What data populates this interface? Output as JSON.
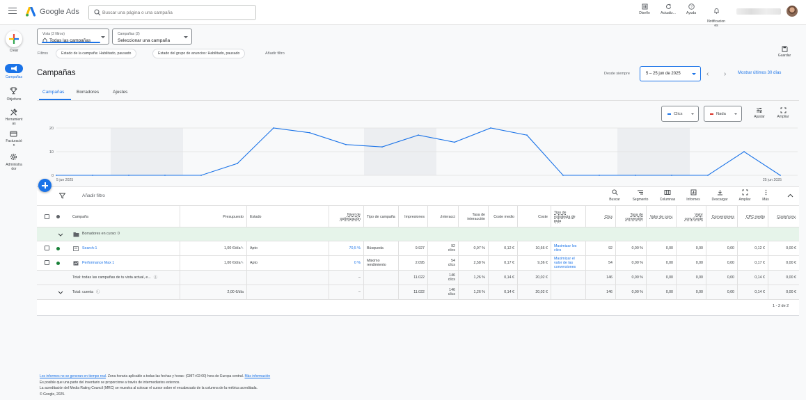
{
  "app": {
    "brand": "Google Ads"
  },
  "search": {
    "placeholder": "Buscar una página o una campaña"
  },
  "toolbar": {
    "items": [
      "Diseño",
      "Actualiz...",
      "Ayuda",
      "Notificacion\nes"
    ]
  },
  "rail": {
    "items": [
      "Crear",
      "Campañas",
      "Objetivos",
      "Herramient\nas",
      "Facturació\nn",
      "Administra\ndor"
    ]
  },
  "view_select": {
    "label": "Vista (2 filtros)",
    "value": "Todas las campañas"
  },
  "campaign_select": {
    "label": "Campañas (2)",
    "value": "Seleccionar una campaña"
  },
  "filters": {
    "label": "Filtros",
    "chips": [
      "Estado de la campaña: Habilitado, pausado",
      "Estado del grupo de anuncios: Habilitado, pausado"
    ],
    "add": "Añadir filtro",
    "save": "Guardar"
  },
  "page": {
    "title": "Campañas"
  },
  "tabs": [
    "Campañas",
    "Borradores",
    "Ajustes"
  ],
  "date": {
    "since": "Desde siempre",
    "range": "5 – 25 jun de 2025",
    "show_last": "Mostrar últimos 30 días"
  },
  "metrics": {
    "primary": "Clics",
    "primary_color": "#1a73e8",
    "secondary": "Nada",
    "secondary_color": "#d93025"
  },
  "chart_tools": [
    "Ajustar",
    "Ampliar"
  ],
  "chart_data": {
    "type": "line",
    "x": [
      "5 jun 2025",
      "6 jun",
      "7 jun",
      "8 jun",
      "9 jun",
      "10 jun",
      "11 jun",
      "12 jun",
      "13 jun",
      "14 jun",
      "15 jun",
      "16 jun",
      "17 jun",
      "18 jun",
      "19 jun",
      "20 jun",
      "21 jun",
      "22 jun",
      "23 jun",
      "24 jun",
      "25 jun 2025"
    ],
    "series": [
      {
        "values": [
          0,
          0,
          0,
          0,
          0,
          5,
          20,
          18,
          13,
          12,
          17,
          14,
          20,
          17,
          0,
          0,
          0,
          0,
          0,
          10,
          0
        ]
      }
    ],
    "ylim": [
      0,
      20
    ],
    "yticks": [
      "0",
      "10",
      "20"
    ],
    "x_tick_labels": [
      "5 jun 2025",
      "25 jun 2025"
    ],
    "shaded_weekends": true,
    "grid": true
  },
  "table_toolbar": {
    "add_filter": "Añadir filtro",
    "tools": [
      "Buscar",
      "Segmento",
      "Columnas",
      "Informes",
      "Descargar",
      "Ampliar",
      "Más"
    ]
  },
  "columns": [
    "Campaña",
    "Presupuesto",
    "Estado",
    "Nivel de optimización",
    "Tipo de campaña",
    "Impresiones",
    "Interacci",
    "Tasa de interacción",
    "Coste medio",
    "Coste",
    "Tipo de estrategia de puja",
    "Clics",
    "Tasa de conversión",
    "Valor de conv.",
    "Valor conv./coste",
    "Conversiones",
    "CPC medio",
    "Coste/conv."
  ],
  "drafts_row": "Borradores en curso: 0",
  "rows": [
    {
      "name": "Search-1",
      "budget": "1,00 €/día",
      "status": "Apto",
      "opt": "70,5 %",
      "type": "Búsqueda",
      "impr": "9.927",
      "inter": "92\nclics",
      "rate": "0,97 %",
      "avg": "0,12 €",
      "cost": "10,66 €",
      "strategy": "Maximizar los\nclics",
      "clicks": "92",
      "conv_rate": "0,00 %",
      "conv_val": "0,00",
      "val_cost": "0,00",
      "conv": "0,00",
      "cpc": "0,12 €",
      "cpa": "0,00 €"
    },
    {
      "name": "Performance Max 1",
      "budget": "1,00 €/día",
      "status": "Apto",
      "opt": "0 %",
      "type": "Máximo\nrendimiento",
      "impr": "2.095",
      "inter": "54\nclics",
      "rate": "2,58 %",
      "avg": "0,17 €",
      "cost": "9,36 €",
      "strategy": "Maximizar el\nvalor de las\nconversiones",
      "clicks": "54",
      "conv_rate": "0,00 %",
      "conv_val": "0,00",
      "val_cost": "0,00",
      "conv": "0,00",
      "cpc": "0,17 €",
      "cpa": "0,00 €"
    }
  ],
  "totals": [
    {
      "name": "Total: todas las campañas de tu vista actual, e...",
      "budget": "",
      "opt": "–",
      "impr": "11.022",
      "inter": "146\nclics",
      "rate": "1,26 %",
      "avg": "0,14 €",
      "cost": "20,02 €",
      "clicks": "146",
      "conv_rate": "0,00 %",
      "conv_val": "0,00",
      "val_cost": "0,00",
      "conv": "0,00",
      "cpc": "0,14 €",
      "cpa": "0,00 €"
    },
    {
      "name": "Total: cuenta",
      "budget": "2,00 €/día",
      "opt": "–",
      "impr": "11.022",
      "inter": "146\nclics",
      "rate": "1,26 %",
      "avg": "0,14 €",
      "cost": "20,02 €",
      "clicks": "146",
      "conv_rate": "0,00 %",
      "conv_val": "0,00",
      "val_cost": "0,00",
      "conv": "0,00",
      "cpc": "0,14 €",
      "cpa": "0,00 €"
    }
  ],
  "pagination": "1 - 2 de 2",
  "footer": {
    "line1_link": "Los informes no se generan en tiempo real",
    "line1_text": ". Zona horaria aplicable a todas las fechas y horas: (GMT+02:00) hora de Europa central.",
    "line1_more": "Más información",
    "line2": "Es posible que una parte del inventario se proporcione a través de intermediarios externos.",
    "line3": "La acreditación del Media Rating Council (MRC) se muestra al colocar el cursor sobre el encabezado de la columna de la métrica acreditada.",
    "line4": "© Google, 2025."
  }
}
